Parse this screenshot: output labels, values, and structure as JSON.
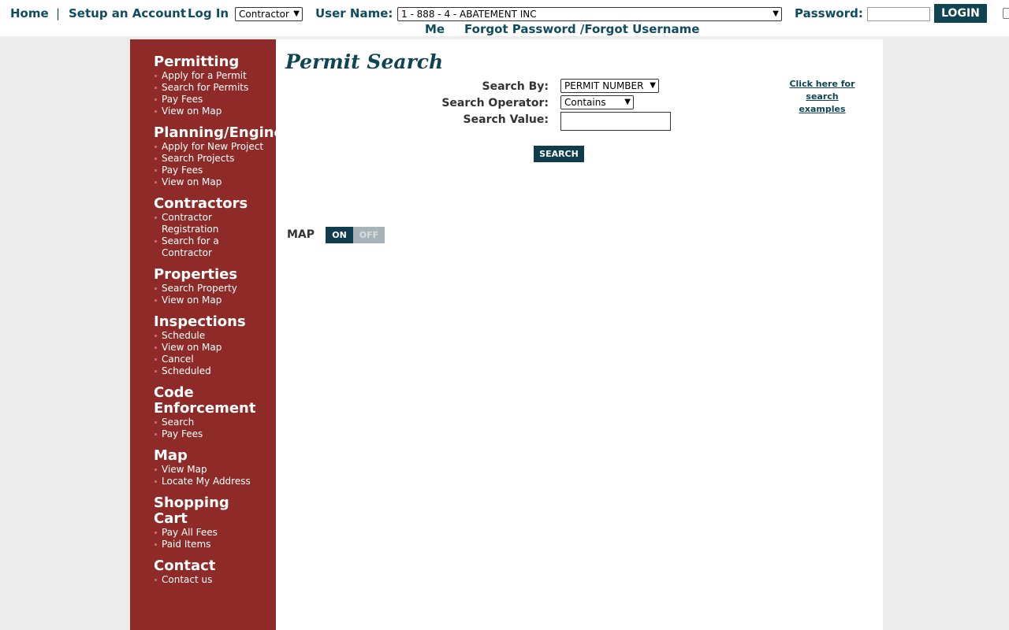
{
  "topbar": {
    "home": "Home",
    "separator": "|",
    "setup_account": "Setup an Account",
    "log_in": "Log In",
    "user_type_selected": "Contractor",
    "user_name_label": "User Name:",
    "user_name_selected": "1 - 888 - 4 - ABATEMENT INC",
    "password_label": "Password:",
    "login_button": "LOGIN",
    "remember_me": "Me",
    "forgot": "Forgot Password /Forgot Username"
  },
  "sidebar": {
    "sections": [
      {
        "heading": "Permitting",
        "items": [
          "Apply for a Permit",
          "Search for Permits",
          "Pay Fees",
          "View on Map"
        ]
      },
      {
        "heading": "Planning/Engineering",
        "items": [
          "Apply for New Project",
          "Search Projects",
          "Pay Fees",
          "View on Map"
        ]
      },
      {
        "heading": "Contractors",
        "items": [
          "Contractor Registration",
          "Search for a Contractor"
        ]
      },
      {
        "heading": "Properties",
        "items": [
          "Search Property",
          "View on Map"
        ]
      },
      {
        "heading": "Inspections",
        "items": [
          "Schedule",
          "View on Map",
          "Cancel",
          "Scheduled"
        ]
      },
      {
        "heading": "Code Enforcement",
        "items": [
          "Search",
          "Pay Fees"
        ]
      },
      {
        "heading": "Map",
        "items": [
          "View Map",
          "Locate My Address"
        ]
      },
      {
        "heading": "Shopping Cart",
        "items": [
          "Pay All Fees",
          "Paid Items"
        ]
      },
      {
        "heading": "Contact",
        "items": [
          "Contact us"
        ]
      }
    ]
  },
  "main": {
    "title": "Permit Search",
    "search_by_label": "Search By:",
    "search_by_selected": "PERMIT NUMBER",
    "operator_label": "Search Operator:",
    "operator_selected": "Contains",
    "value_label": "Search Value:",
    "search_value": "",
    "search_button": "SEARCH",
    "examples_link": "Click here for search examples",
    "map_label": "MAP",
    "map_toggle_on": "ON",
    "map_toggle_off": "OFF"
  },
  "colors": {
    "accent": "#0f4552",
    "sidebar_bg": "#8e2b28",
    "page_bg": "#ececec"
  }
}
